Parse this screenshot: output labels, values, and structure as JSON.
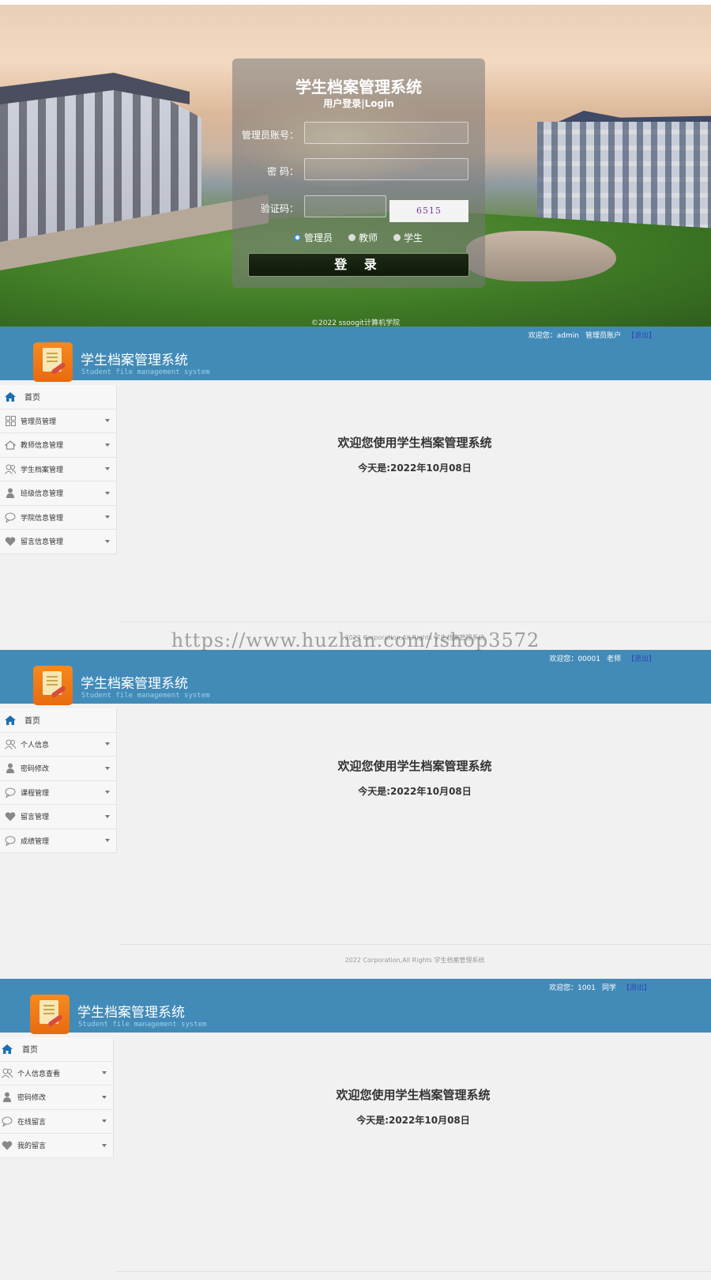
{
  "login": {
    "title": "学生档案管理系统",
    "subtitle": "用户登录|Login",
    "account_label": "管理员账号：",
    "password_label": "密 码：",
    "captcha_label": "验证码：",
    "captcha_text": "6515",
    "roles": [
      {
        "label": "管理员",
        "selected": true
      },
      {
        "label": "教师",
        "selected": false
      },
      {
        "label": "学生",
        "selected": false
      }
    ],
    "submit_label": "登 录",
    "copyright": "©2022 ssoogit计算机学院"
  },
  "brand": {
    "title": "学生档案管理系统",
    "subtitle": "Student file management system"
  },
  "home_label": "首页",
  "welcome_heading": "欢迎您使用学生档案管理系统",
  "date_line": "今天是:2022年10月08日",
  "footer": "2022 Corporation,All Rights 学生档案管理系统",
  "watermark": "https://www.huzhan.com/ishop3572",
  "logout_label": "【退出】",
  "colors": {
    "topbar": "#428bb8",
    "accent": "#1a6fb0",
    "logo": "#f58a1e"
  },
  "admin": {
    "user": "欢迎您：admin",
    "role": "管理员账户",
    "menu": [
      {
        "label": "管理员管理",
        "icon": "grid-icon"
      },
      {
        "label": "教师信息管理",
        "icon": "house-icon"
      },
      {
        "label": "学生档案管理",
        "icon": "users-icon"
      },
      {
        "label": "班级信息管理",
        "icon": "person-icon"
      },
      {
        "label": "学院信息管理",
        "icon": "chat-icon"
      },
      {
        "label": "留言信息管理",
        "icon": "heart-icon"
      }
    ]
  },
  "teacher": {
    "user": "欢迎您：00001",
    "role": "老师",
    "menu": [
      {
        "label": "个人信息",
        "icon": "users-icon"
      },
      {
        "label": "密码修改",
        "icon": "person-icon"
      },
      {
        "label": "课程管理",
        "icon": "chat-icon"
      },
      {
        "label": "留言管理",
        "icon": "heart-icon"
      },
      {
        "label": "成绩管理",
        "icon": "chat-icon"
      }
    ]
  },
  "student": {
    "user": "欢迎您：1001",
    "role": "同学",
    "menu": [
      {
        "label": "个人信息查看",
        "icon": "users-icon"
      },
      {
        "label": "密码修改",
        "icon": "person-icon"
      },
      {
        "label": "在线留言",
        "icon": "chat-icon"
      },
      {
        "label": "我的留言",
        "icon": "heart-icon"
      }
    ]
  }
}
